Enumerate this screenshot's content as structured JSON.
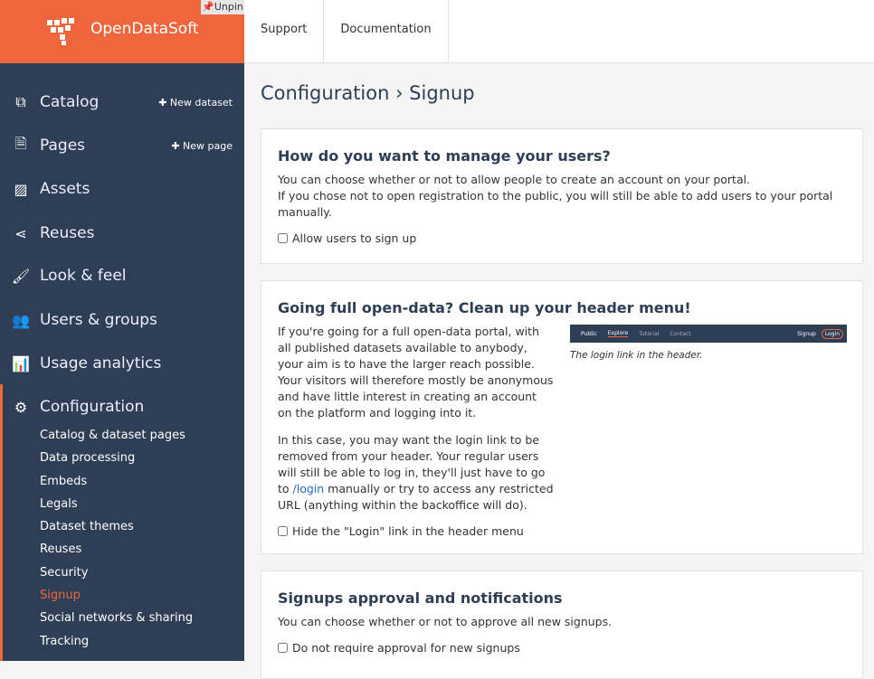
{
  "brand": {
    "name": "OpenDataSoft",
    "unpin": "Unpin",
    "color": "#ef663c"
  },
  "topnav": [
    "Support",
    "Documentation"
  ],
  "sidebar": {
    "items": [
      {
        "label": "Catalog",
        "icon": "catalog-icon",
        "action": "✚ New dataset"
      },
      {
        "label": "Pages",
        "icon": "page-icon",
        "action": "✚ New page"
      },
      {
        "label": "Assets",
        "icon": "image-icon"
      },
      {
        "label": "Reuses",
        "icon": "share-icon"
      },
      {
        "label": "Look & feel",
        "icon": "brush-icon"
      },
      {
        "label": "Users & groups",
        "icon": "users-icon"
      },
      {
        "label": "Usage analytics",
        "icon": "chart-icon"
      },
      {
        "label": "Configuration",
        "icon": "gears-icon"
      }
    ],
    "sub": [
      "Catalog & dataset pages",
      "Data processing",
      "Embeds",
      "Legals",
      "Dataset themes",
      "Reuses",
      "Security",
      "Signup",
      "Social networks & sharing",
      "Tracking"
    ],
    "active_sub": "Signup"
  },
  "main": {
    "title": "Configuration › Signup",
    "card1": {
      "title": "How do you want to manage your users?",
      "p1": "You can choose whether or not to allow people to create an account on your portal.",
      "p2": "If you chose not to open registration to the public, you will still be able to add users to your portal manually.",
      "checkbox": "Allow users to sign up"
    },
    "card2": {
      "title": "Going full open-data? Clean up your header menu!",
      "p1": "If you're going for a full open-data portal, with all published datasets available to anybody, your aim is to have the larger reach possible. Your visitors will therefore mostly be anonymous and have little interest in creating an account on the platform and logging into it.",
      "p2a": "In this case, you may want the login link to be removed from your header. Your regular users will still be able to log in, they'll just have to go to ",
      "link": "/login",
      "p2b": " manually or try to access any restricted URL (anything within the backoffice will do).",
      "checkbox": "Hide the \"Login\" link in the header menu",
      "mock": {
        "brand": "Public",
        "tabs": [
          "Explore",
          "Tutorial",
          "Contact"
        ],
        "signup": "Signup",
        "login": "Login"
      },
      "caption": "The login link in the header."
    },
    "card3": {
      "title": "Signups approval and notifications",
      "p1": "You can choose whether or not to approve all new signups.",
      "checkbox": "Do not require approval for new signups"
    }
  }
}
